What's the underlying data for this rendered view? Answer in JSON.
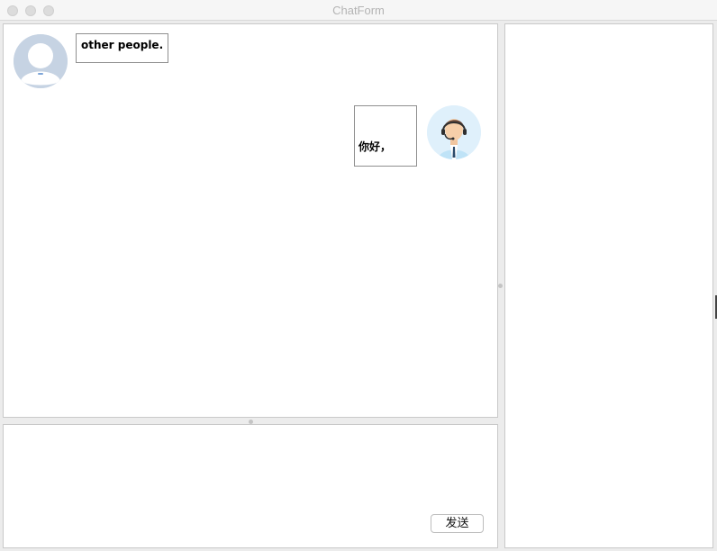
{
  "window": {
    "title": "ChatForm",
    "traffic_lights": [
      "close-icon",
      "minimize-icon",
      "zoom-icon"
    ]
  },
  "chat": {
    "messages": [
      {
        "side": "left",
        "avatar": "default-user-avatar",
        "text": "other people."
      },
      {
        "side": "right",
        "avatar": "agent-with-headset-avatar",
        "text": "你好，"
      }
    ]
  },
  "input": {
    "text": "",
    "send_label": "发送"
  },
  "colors": {
    "window_bg": "#ececec",
    "panel_bg": "#ffffff",
    "other_avatar_bg": "#c6d3e3",
    "self_avatar_bg": "#dff0fb"
  }
}
